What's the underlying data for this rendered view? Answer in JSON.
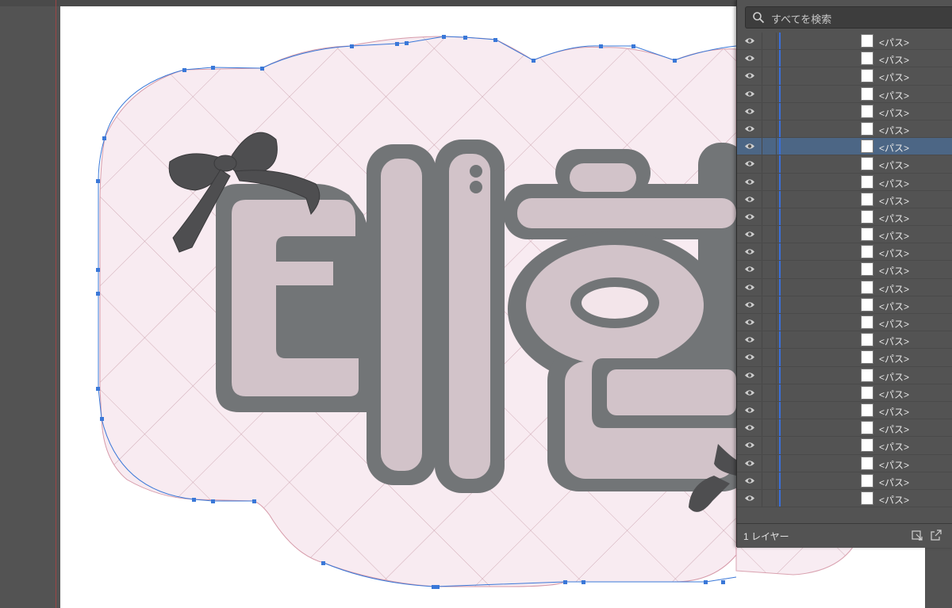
{
  "layers_panel": {
    "search_placeholder": "すべてを検索",
    "rows": [
      {
        "name": "<パス>",
        "selected": false
      },
      {
        "name": "<パス>",
        "selected": false
      },
      {
        "name": "<パス>",
        "selected": false
      },
      {
        "name": "<パス>",
        "selected": false
      },
      {
        "name": "<パス>",
        "selected": false
      },
      {
        "name": "<パス>",
        "selected": false
      },
      {
        "name": "<パス>",
        "selected": true
      },
      {
        "name": "<パス>",
        "selected": false
      },
      {
        "name": "<パス>",
        "selected": false
      },
      {
        "name": "<パス>",
        "selected": false
      },
      {
        "name": "<パス>",
        "selected": false
      },
      {
        "name": "<パス>",
        "selected": false
      },
      {
        "name": "<パス>",
        "selected": false
      },
      {
        "name": "<パス>",
        "selected": false
      },
      {
        "name": "<パス>",
        "selected": false
      },
      {
        "name": "<パス>",
        "selected": false
      },
      {
        "name": "<パス>",
        "selected": false
      },
      {
        "name": "<パス>",
        "selected": false
      },
      {
        "name": "<パス>",
        "selected": false
      },
      {
        "name": "<パス>",
        "selected": false
      },
      {
        "name": "<パス>",
        "selected": false
      },
      {
        "name": "<パス>",
        "selected": false
      },
      {
        "name": "<パス>",
        "selected": false
      },
      {
        "name": "<パス>",
        "selected": false
      },
      {
        "name": "<パス>",
        "selected": false
      },
      {
        "name": "<パス>",
        "selected": false
      },
      {
        "name": "<パス>",
        "selected": false
      }
    ],
    "footer_label": "1 レイヤー"
  },
  "artwork": {
    "text": "태현",
    "fill_color": "#d2c3c9",
    "outline_color": "#727577",
    "background_color": "#f8ebf1",
    "ribbon_color": "#4e4e50",
    "selection_color": "#3a78d8"
  },
  "icons": [
    "search-icon",
    "eye-icon",
    "collect-for-export-icon",
    "export-icon",
    "ribbon-icon"
  ]
}
